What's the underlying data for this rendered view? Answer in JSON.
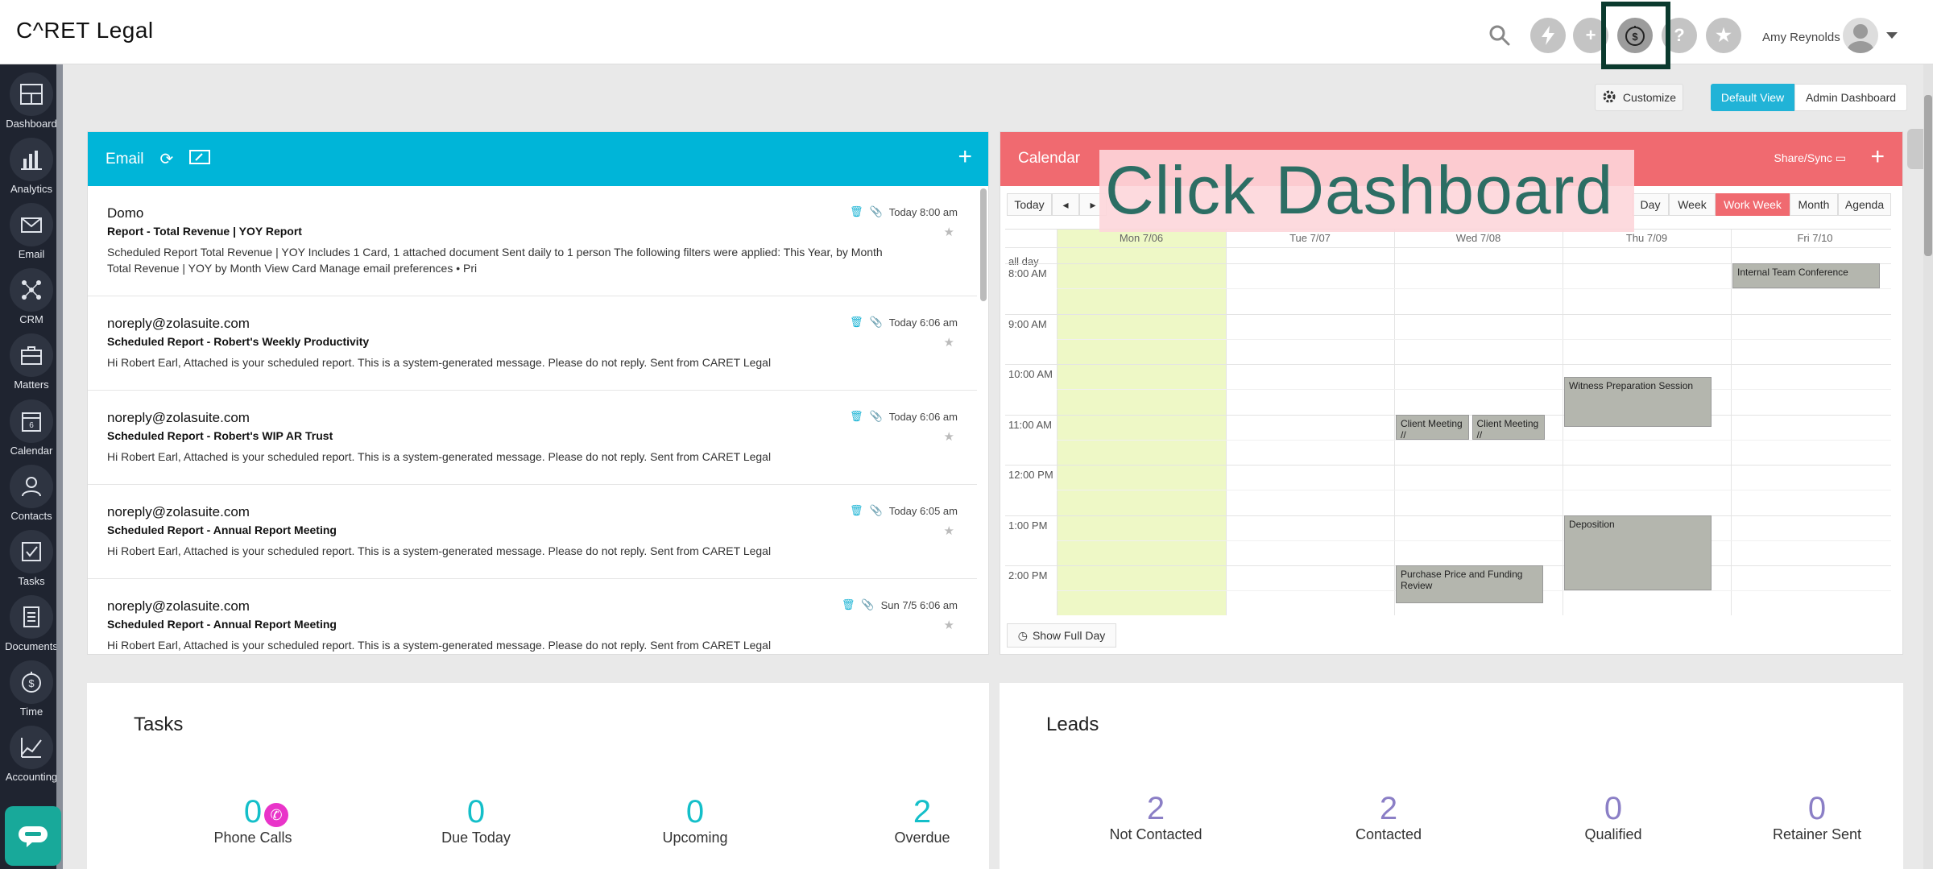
{
  "app": {
    "logo": "C^RET Legal"
  },
  "topbar": {
    "icons": [
      "search-icon",
      "lightning-icon",
      "plus-icon",
      "timer-icon",
      "help-icon",
      "star-icon"
    ],
    "user_name": "Amy Reynolds"
  },
  "sidebar": {
    "items": [
      {
        "label": "Dashboard",
        "icon": "dashboard-icon"
      },
      {
        "label": "Analytics",
        "icon": "analytics-icon"
      },
      {
        "label": "Email",
        "icon": "email-icon"
      },
      {
        "label": "CRM",
        "icon": "crm-icon"
      },
      {
        "label": "Matters",
        "icon": "briefcase-icon"
      },
      {
        "label": "Calendar",
        "icon": "calendar-icon"
      },
      {
        "label": "Contacts",
        "icon": "contacts-icon"
      },
      {
        "label": "Tasks",
        "icon": "tasks-icon"
      },
      {
        "label": "Documents",
        "icon": "documents-icon"
      },
      {
        "label": "Time",
        "icon": "time-icon"
      },
      {
        "label": "Accounting",
        "icon": "accounting-icon"
      }
    ]
  },
  "toolbar": {
    "customize": "Customize",
    "default_view": "Default View",
    "admin_dashboard": "Admin Dashboard"
  },
  "email": {
    "title": "Email",
    "items": [
      {
        "from": "Domo",
        "subject": "Report - Total Revenue | YOY Report",
        "body": "Scheduled Report Total Revenue | YOY Includes 1 Card, 1 attached document Sent daily to 1 person The following filters were applied: This Year, by Month Total Revenue | YOY by Month View Card Manage email preferences • Pri",
        "time": "Today 8:00 am"
      },
      {
        "from": "noreply@zolasuite.com",
        "subject": "Scheduled Report - Robert's Weekly Productivity",
        "body": "Hi Robert Earl, Attached is your scheduled report. This is a system-generated message. Please do not reply. Sent from CARET Legal",
        "time": "Today 6:06 am"
      },
      {
        "from": "noreply@zolasuite.com",
        "subject": "Scheduled Report - Robert's WIP AR Trust",
        "body": "Hi Robert Earl, Attached is your scheduled report. This is a system-generated message. Please do not reply. Sent from CARET Legal",
        "time": "Today 6:06 am"
      },
      {
        "from": "noreply@zolasuite.com",
        "subject": "Scheduled Report - Annual Report Meeting",
        "body": "Hi Robert Earl, Attached is your scheduled report. This is a system-generated message. Please do not reply. Sent from CARET Legal",
        "time": "Today 6:05 am"
      },
      {
        "from": "noreply@zolasuite.com",
        "subject": "Scheduled Report - Annual Report Meeting",
        "body": "Hi Robert Earl, Attached is your scheduled report. This is a system-generated message. Please do not reply. Sent from CARET Legal",
        "time": "Sun 7/5 6:06 am"
      }
    ]
  },
  "calendar": {
    "title": "Calendar",
    "share": "Share/Sync",
    "today": "Today",
    "views": [
      "Day",
      "Week",
      "Work Week",
      "Month",
      "Agenda"
    ],
    "active_view": "Work Week",
    "days": [
      "Mon 7/06",
      "Tue 7/07",
      "Wed 7/08",
      "Thu 7/09",
      "Fri 7/10"
    ],
    "all_day": "all day",
    "times": [
      "8:00 AM",
      "9:00 AM",
      "10:00 AM",
      "11:00 AM",
      "12:00 PM",
      "1:00 PM",
      "2:00 PM"
    ],
    "events": [
      {
        "title": "Internal Team Conference",
        "day": 4,
        "start": 8.0,
        "end": 8.5
      },
      {
        "title": "Witness Preparation Session",
        "day": 3,
        "start": 10.25,
        "end": 11.25
      },
      {
        "title": "Client Meeting //",
        "day": 2,
        "start": 11.0,
        "end": 11.5
      },
      {
        "title": "Client Meeting //",
        "day": 2,
        "start": 11.0,
        "end": 11.5
      },
      {
        "title": "Deposition",
        "day": 3,
        "start": 13.0,
        "end": 14.5
      },
      {
        "title": "Purchase Price and Funding Review",
        "day": 2,
        "start": 14.0,
        "end": 14.75
      }
    ],
    "show_full_day": "Show Full Day"
  },
  "overlay": {
    "hint": "Click Dashboard"
  },
  "tasks": {
    "title": "Tasks",
    "stats": [
      {
        "value": "0",
        "label": "Phone Calls"
      },
      {
        "value": "0",
        "label": "Due Today"
      },
      {
        "value": "0",
        "label": "Upcoming"
      },
      {
        "value": "2",
        "label": "Overdue"
      }
    ]
  },
  "leads": {
    "title": "Leads",
    "stats": [
      {
        "value": "2",
        "label": "Not Contacted"
      },
      {
        "value": "2",
        "label": "Contacted"
      },
      {
        "value": "0",
        "label": "Qualified"
      },
      {
        "value": "0",
        "label": "Retainer Sent"
      }
    ]
  },
  "colors": {
    "email_header": "#00b5d8",
    "calendar_header": "#f06a70",
    "sidebar": "#1f2430",
    "today_column": "#eef8c6",
    "tasks_numbers": "#14bfc9",
    "leads_numbers": "#8b7fc6",
    "highlight": "#0b3a2e"
  }
}
